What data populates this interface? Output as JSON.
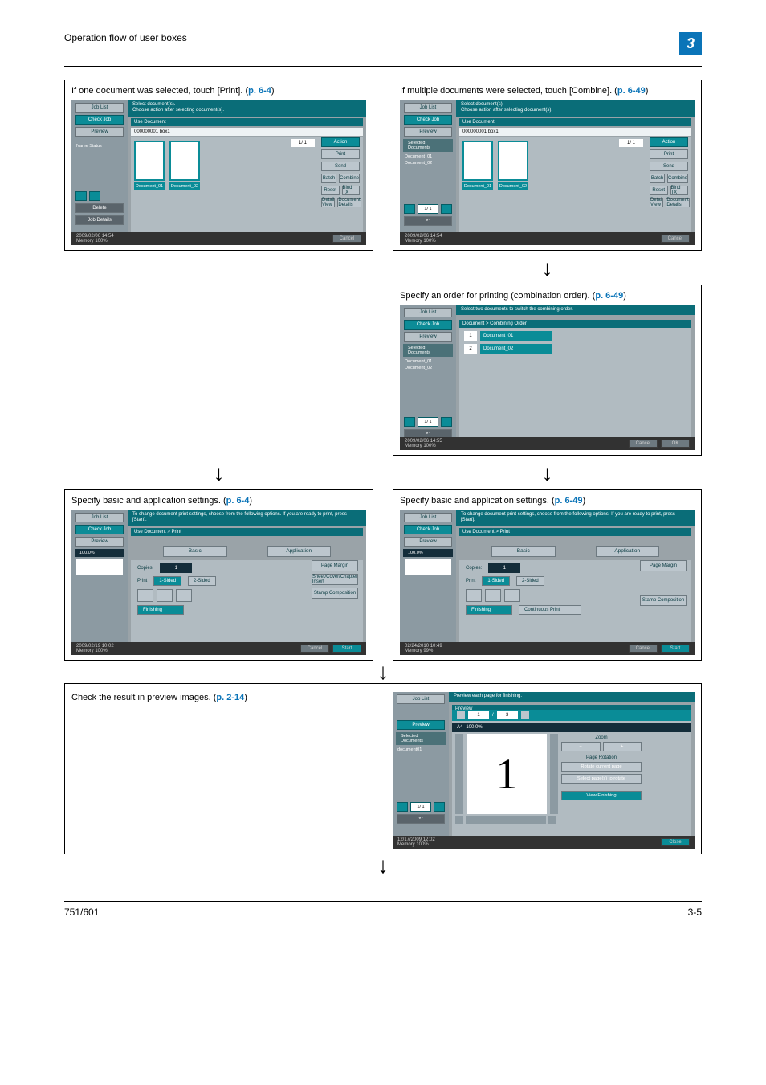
{
  "header": {
    "section_title": "Operation flow of user boxes",
    "chapter": "3"
  },
  "footer": {
    "model": "751/601",
    "page": "3-5"
  },
  "steps": {
    "single_select": {
      "text_a": "If one document was selected, touch [Print]. (",
      "ref": "p. 6-4",
      "text_b": ")"
    },
    "multi_select": {
      "text_a": "If multiple documents were selected, touch [Combine]. (",
      "ref": "p. 6-49",
      "text_b": ")"
    },
    "combine_order": {
      "text_a": "Specify an order for printing (combination order). (",
      "ref": "p. 6-49",
      "text_b": ")"
    },
    "basic_left": {
      "text_a": "Specify basic and application settings. (",
      "ref": "p. 6-4",
      "text_b": ")"
    },
    "basic_right": {
      "text_a": "Specify basic and application settings. (",
      "ref": "p. 6-49",
      "text_b": ")"
    },
    "preview": {
      "text_a": "Check the result in preview images. (",
      "ref": "p. 2-14",
      "text_b": ")"
    }
  },
  "sidebar": {
    "job_list": "Job List",
    "check_job": "Check Job",
    "preview": "Preview",
    "name_status": "Name  Status",
    "delete": "Delete",
    "job_details": "Job Details",
    "selected_docs": "Selected Documents",
    "doc1": "Document_01",
    "doc2": "Document_02"
  },
  "screen_use": {
    "hint1": "Select document(s).",
    "hint2": "Choose action after selecting document(s).",
    "breadcrumb": "Use Document",
    "box_info": "000000001  box1",
    "page_ind": "1/  1",
    "th1": "Document_01",
    "th2": "Document_02",
    "actions": {
      "action": "Action",
      "print": "Print",
      "send": "Send",
      "batch": "Batch",
      "combine": "Combine",
      "reset": "Reset",
      "bind_tx": "Bind TX",
      "detail_view": "Detail View",
      "doc_details": "Document Details"
    },
    "footer": {
      "ts": "2009/02/06   14:54",
      "mem": "Memory        100%",
      "cancel": "Cancel"
    }
  },
  "screen_combine": {
    "hint": "Select two documents to switch the combining order.",
    "breadcrumb": "Document > Combining Order",
    "row1_num": "1",
    "row1_name": "Document_01",
    "row2_num": "2",
    "row2_name": "Document_02",
    "footer": {
      "ts": "2009/02/06   14:55",
      "mem": "Memory        100%",
      "cancel": "Cancel",
      "ok": "OK"
    },
    "page_ind": "1/  1"
  },
  "screen_print": {
    "hint": "To change document print settings, choose from the following options. If you are ready to print, press [Start].",
    "breadcrumb": "Use Document > Print",
    "paper_hint": "100.0%",
    "tabs": {
      "basic": "Basic",
      "application": "Application"
    },
    "copies_label": "Copies:",
    "copies_value": "1",
    "print_label": "Print",
    "one_sided": "1-Sided",
    "two_sided": "2-Sided",
    "finishing": "Finishing",
    "continuous_print": "Continuous Print",
    "side": {
      "page_margin": "Page Margin",
      "sheet_cover": "Sheet/Cover/Chapter Insert",
      "stamp": "Stamp Composition"
    },
    "footer_left": {
      "ts": "2009/02/19   10:02",
      "mem": "Memory        100%"
    },
    "footer_right": {
      "ts": "02/24/2010   10:49",
      "mem": "Memory         99%"
    },
    "cancel": "Cancel",
    "start": "Start"
  },
  "screen_preview": {
    "hint": "Preview each page for finishing.",
    "breadcrumb": "Preview",
    "pv_label": "Preview",
    "pv_page_from": "1",
    "pv_sep": "/",
    "pv_page_to": "3",
    "paper": "A4",
    "scale": "100.0%",
    "big_digit": "1",
    "zoom": "Zoom",
    "rotation_label": "Page Rotation",
    "rotate_btn": "Rotate current page",
    "select_btn": "Select page(s) to rotate",
    "view_finishing": "View Finishing",
    "close": "Close",
    "doc": "document01",
    "footer": {
      "ts": "12/17/2009   12:02",
      "mem": "Memory        100%"
    },
    "page_ind": "1/  1"
  }
}
